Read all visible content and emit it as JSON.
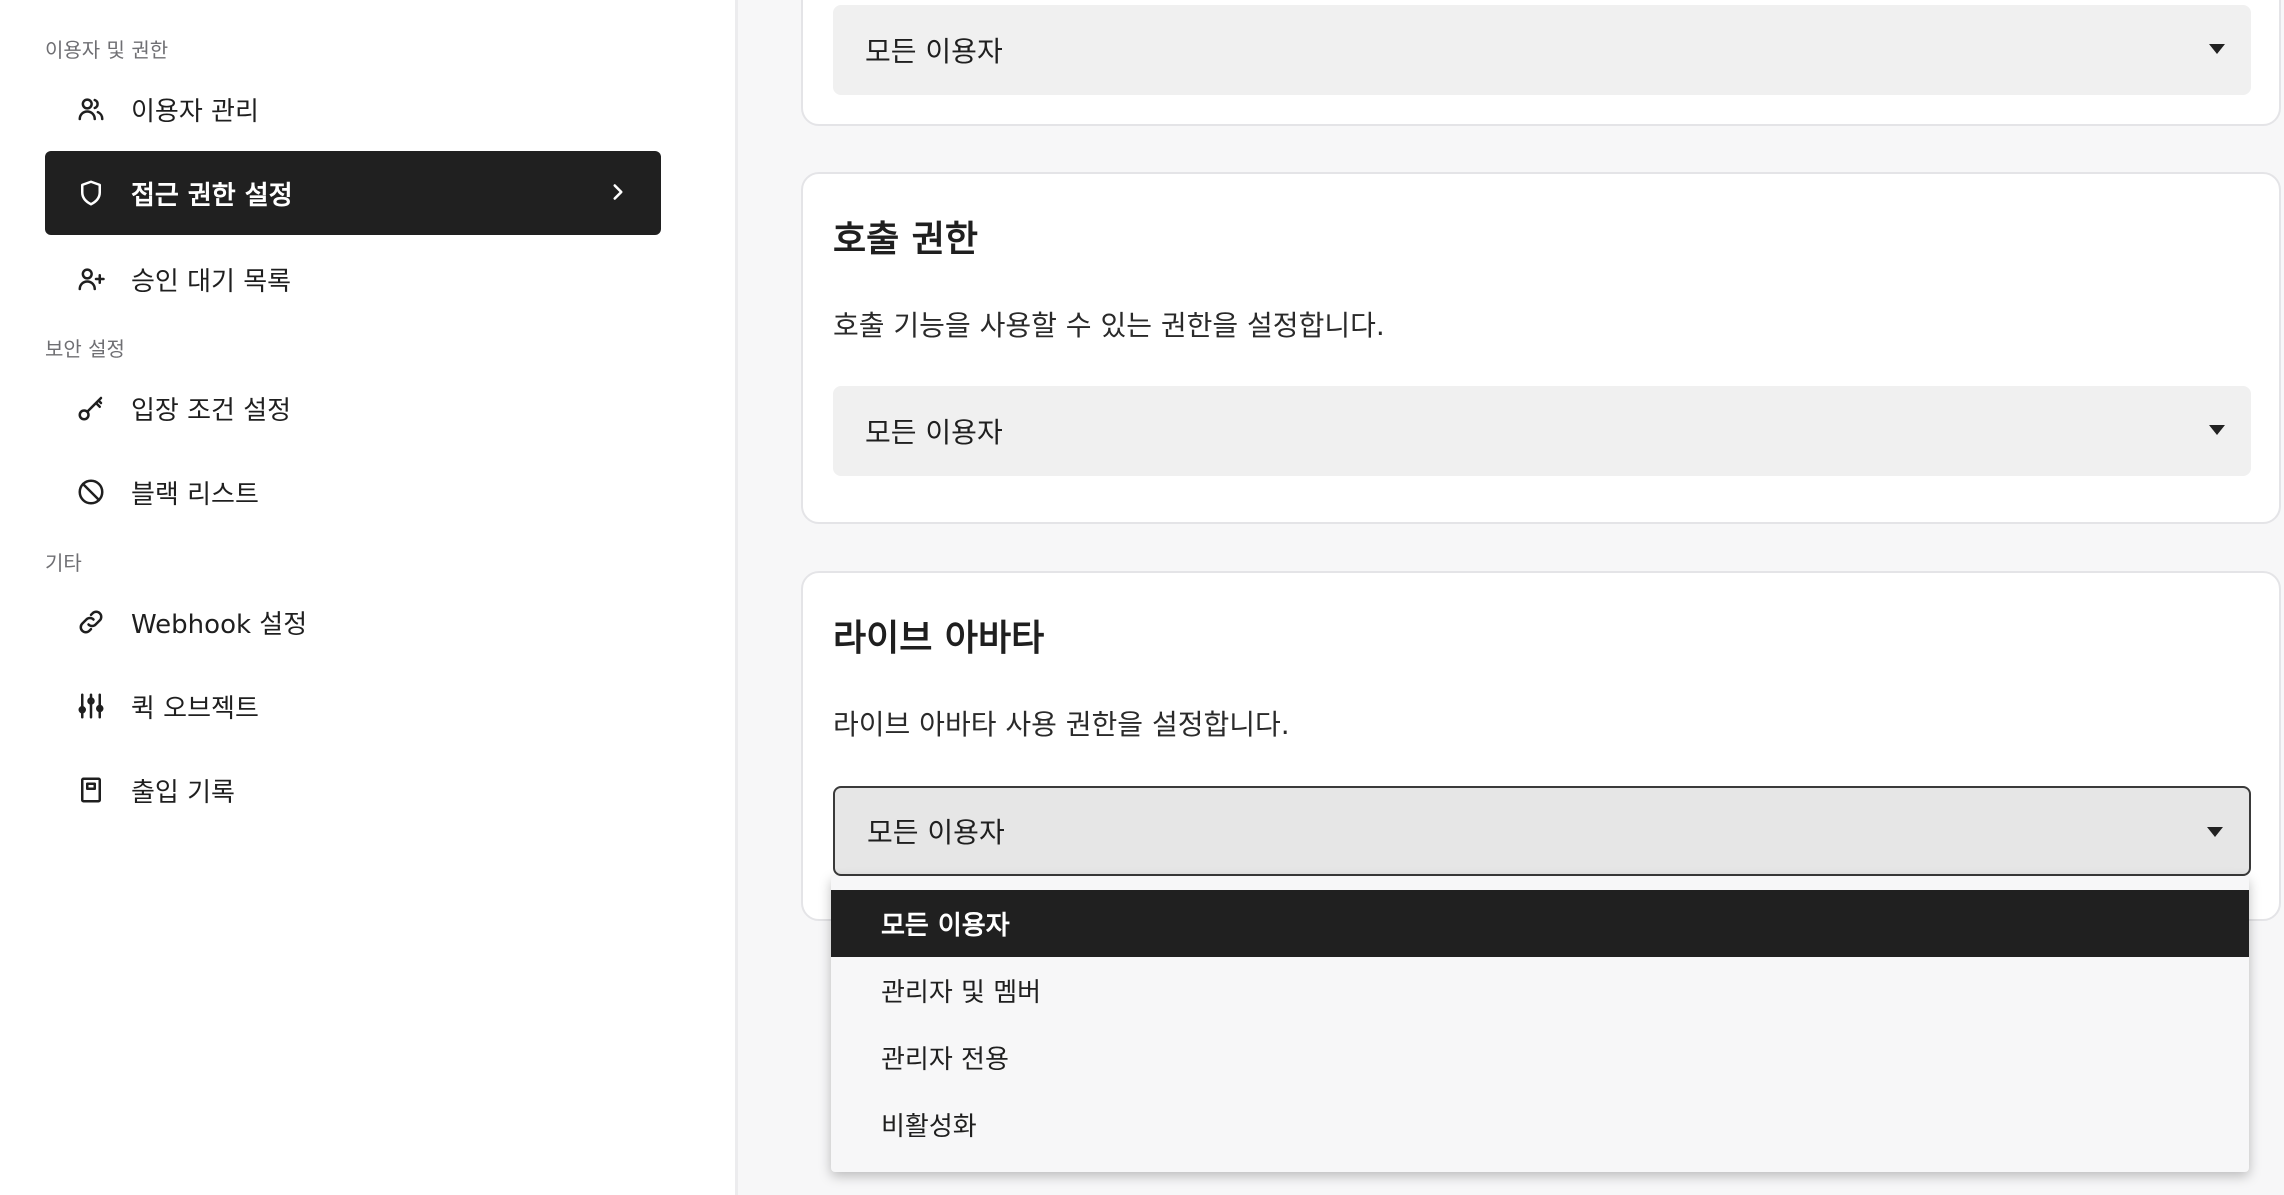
{
  "sidebar": {
    "sections": [
      {
        "label": "이용자 및 권한"
      },
      {
        "label": "보안 설정"
      },
      {
        "label": "기타"
      }
    ],
    "items": [
      {
        "label": "이용자 관리",
        "icon": "users-icon"
      },
      {
        "label": "접근 권한 설정",
        "icon": "shield-icon",
        "active": true
      },
      {
        "label": "승인 대기 목록",
        "icon": "user-plus-icon"
      },
      {
        "label": "입장 조건 설정",
        "icon": "key-icon"
      },
      {
        "label": "블랙 리스트",
        "icon": "ban-icon"
      },
      {
        "label": "Webhook 설정",
        "icon": "link-icon"
      },
      {
        "label": "퀵 오브젝트",
        "icon": "sliders-icon"
      },
      {
        "label": "출입 기록",
        "icon": "log-book-icon"
      }
    ]
  },
  "main": {
    "top_card": {
      "select_value": "모든 이용자"
    },
    "call_card": {
      "title": "호출 권한",
      "description": "호출 기능을 사용할 수 있는 권한을 설정합니다.",
      "select_value": "모든 이용자"
    },
    "avatar_card": {
      "title": "라이브 아바타",
      "description": "라이브 아바타 사용 권한을 설정합니다.",
      "select_value": "모든 이용자"
    },
    "dropdown": {
      "options": [
        "모든 이용자",
        "관리자 및 멤버",
        "관리자 전용",
        "비활성화"
      ],
      "selected": "모든 이용자"
    }
  },
  "colors": {
    "active_bg": "#202020",
    "select_bg": "#f0f0f0",
    "page_bg": "#f7f7f8"
  }
}
